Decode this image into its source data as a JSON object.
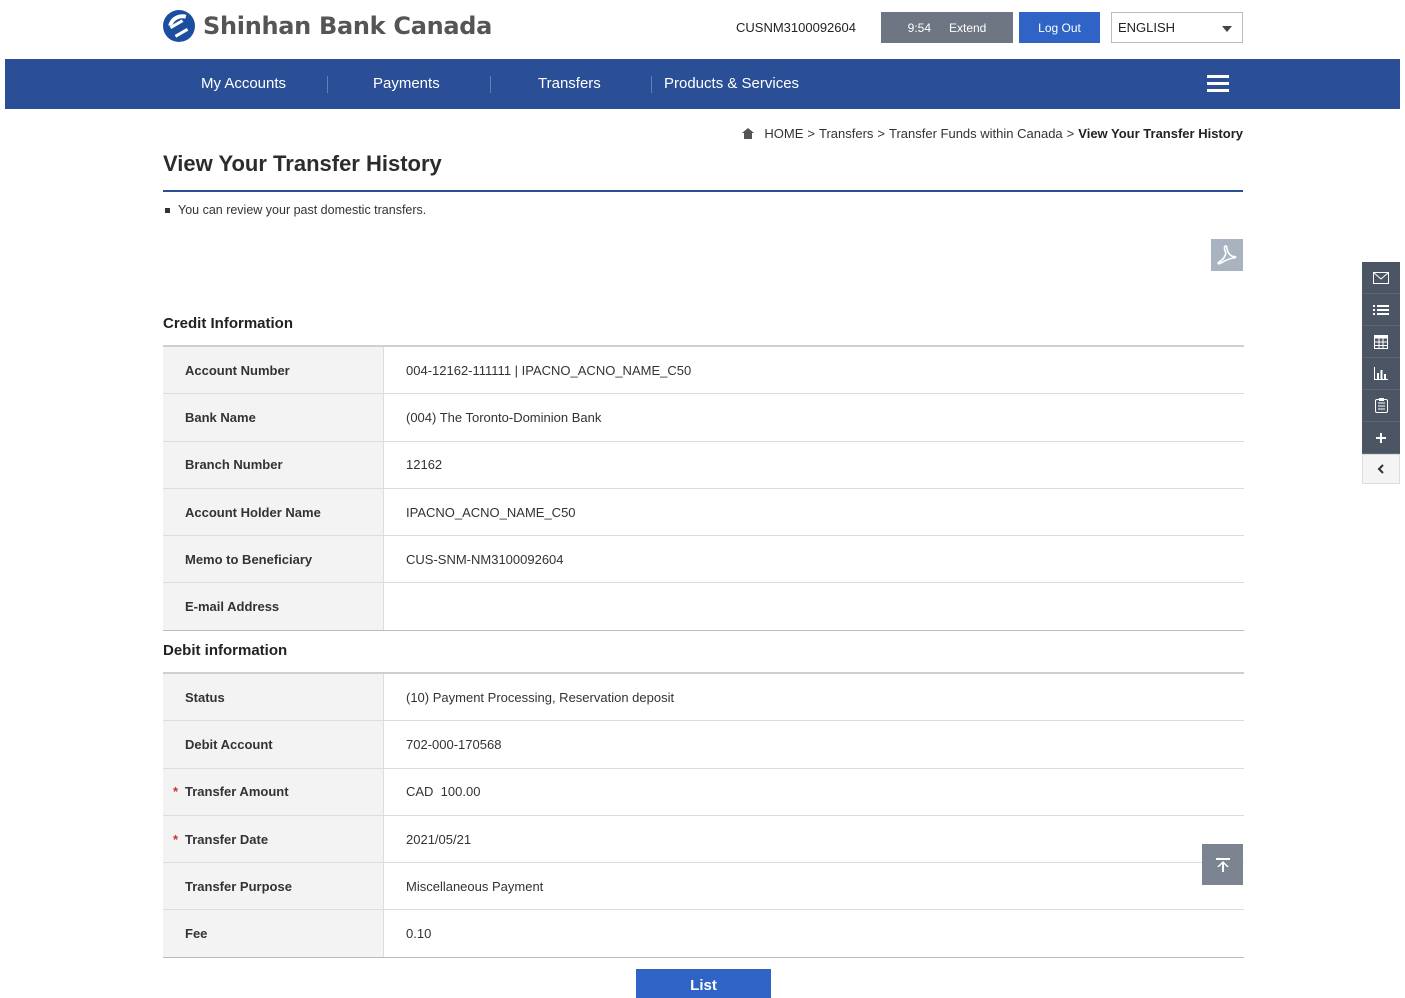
{
  "header": {
    "brand": "Shinhan Bank Canada",
    "user_id": "CUSNM3100092604",
    "session_time": "9:54",
    "extend_label": "Extend",
    "logout_label": "Log Out",
    "language": "ENGLISH"
  },
  "nav": {
    "items": [
      {
        "label": "My Accounts"
      },
      {
        "label": "Payments"
      },
      {
        "label": "Transfers"
      },
      {
        "label": "Products & Services"
      }
    ]
  },
  "breadcrumb": {
    "home": "HOME",
    "sep": ">",
    "items": [
      "Transfers",
      "Transfer Funds within Canada"
    ],
    "current": "View Your Transfer History"
  },
  "page": {
    "title": "View Your Transfer History",
    "description": "You can review your past domestic transfers."
  },
  "credit": {
    "title": "Credit Information",
    "rows": [
      {
        "label": "Account Number",
        "value": "004-12162-111111 | IPACNO_ACNO_NAME_C50"
      },
      {
        "label": "Bank Name",
        "value": "(004) The Toronto-Dominion Bank"
      },
      {
        "label": "Branch Number",
        "value": "12162"
      },
      {
        "label": "Account Holder Name",
        "value": "IPACNO_ACNO_NAME_C50"
      },
      {
        "label": "Memo to Beneficiary",
        "value": "CUS-SNM-NM3100092604"
      },
      {
        "label": "E-mail Address",
        "value": ""
      }
    ]
  },
  "debit": {
    "title": "Debit information",
    "rows": [
      {
        "label": "Status",
        "value": "(10) Payment Processing, Reservation deposit"
      },
      {
        "label": "Debit Account",
        "value": "702-000-170568"
      },
      {
        "label": "Transfer Amount",
        "value": "CAD  100.00",
        "required": "*"
      },
      {
        "label": "Transfer Date",
        "value": "2021/05/21",
        "required": "*"
      },
      {
        "label": "Transfer Purpose",
        "value": "Miscellaneous Payment"
      },
      {
        "label": "Fee",
        "value": "0.10"
      }
    ]
  },
  "actions": {
    "list_label": "List"
  },
  "quick_menu": {
    "icons": [
      "mail-icon",
      "list-icon",
      "calculator-icon",
      "chart-icon",
      "notepad-icon",
      "plus-icon",
      "chevron-left-icon"
    ]
  },
  "colors": {
    "nav_bg": "#2b4f96",
    "primary_button": "#2f63c5",
    "extend_button": "#6d7682"
  }
}
